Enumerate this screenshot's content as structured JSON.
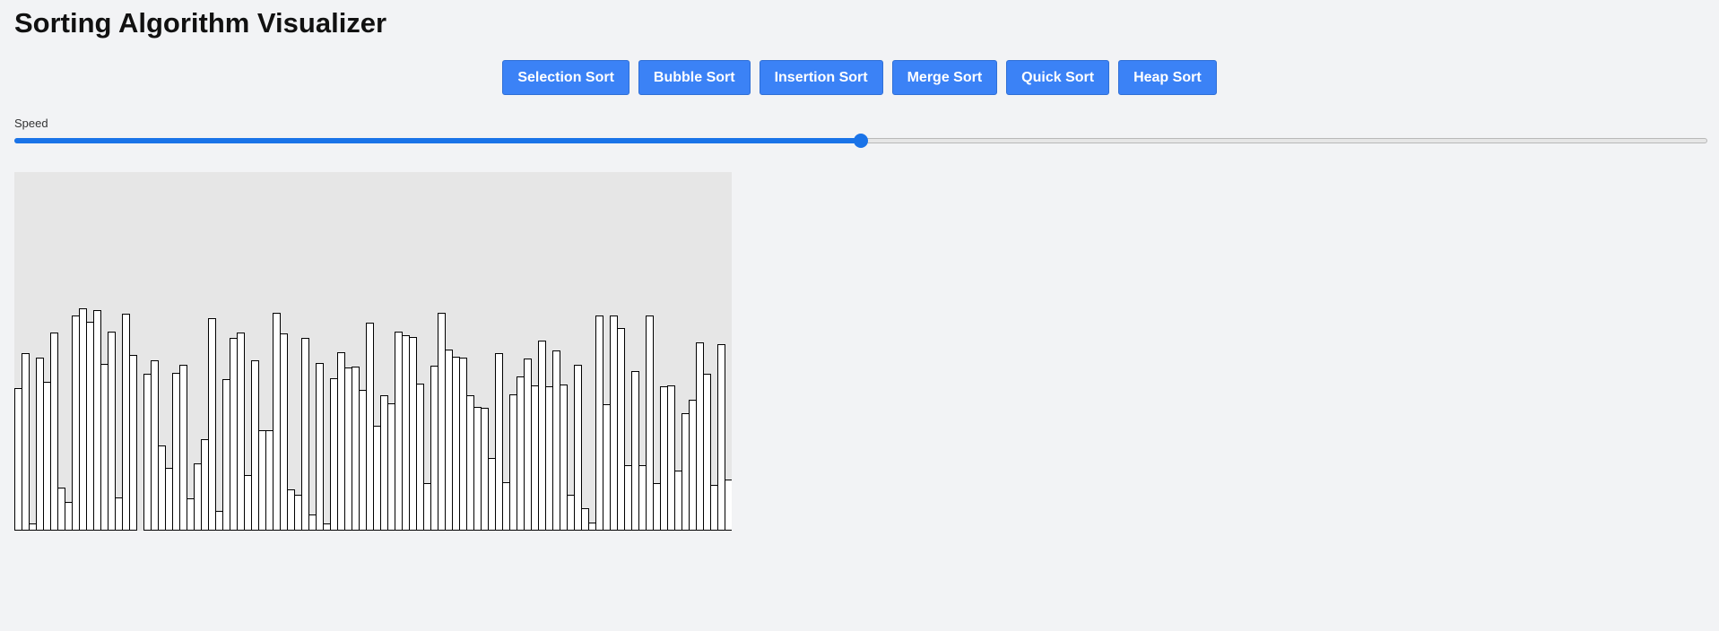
{
  "title": "Sorting Algorithm Visualizer",
  "buttons": [
    {
      "label": "Selection Sort"
    },
    {
      "label": "Bubble Sort"
    },
    {
      "label": "Insertion Sort"
    },
    {
      "label": "Merge Sort"
    },
    {
      "label": "Quick Sort"
    },
    {
      "label": "Heap Sort"
    }
  ],
  "speed": {
    "label": "Speed",
    "value_fraction": 0.5
  },
  "colors": {
    "accent": "#3b82f6",
    "slider": "#1a73e8",
    "bar_fill": "#ffffff",
    "bar_stroke": "#000000",
    "canvas_bg": "#e6e6e6"
  },
  "array": [
    159,
    198,
    8,
    193,
    166,
    221,
    48,
    32,
    240,
    248,
    233,
    246,
    186,
    222,
    37,
    242,
    196,
    0,
    175,
    190,
    95,
    70,
    176,
    185,
    36,
    75,
    102,
    237,
    22,
    169,
    215,
    221,
    62,
    190,
    112,
    112,
    243,
    220,
    46,
    40,
    215,
    18,
    187,
    8,
    170,
    199,
    182,
    183,
    157,
    232,
    117,
    151,
    142,
    222,
    218,
    216,
    164,
    53,
    184,
    243,
    202,
    194,
    193,
    151,
    138,
    137,
    81,
    198,
    54,
    152,
    172,
    192,
    162,
    212,
    161,
    201,
    163,
    40,
    185,
    25,
    9,
    240,
    141,
    240,
    226,
    73,
    178,
    73,
    240,
    53,
    161,
    162,
    67,
    131,
    146,
    210,
    175,
    51,
    208,
    57
  ]
}
